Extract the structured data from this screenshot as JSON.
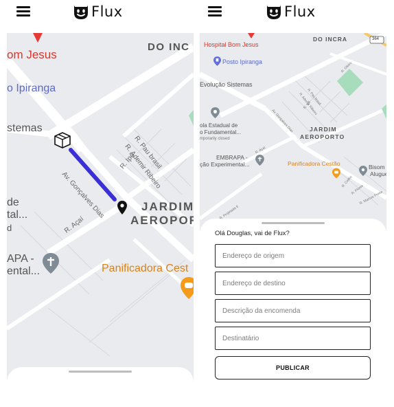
{
  "app": {
    "brand": "Flux"
  },
  "left_screen": {
    "map_labels": {
      "bom_jesus": "om Jesus",
      "ipiranga": "o Ipiranga",
      "sistemas": "stemas",
      "do_inc": "DO INC",
      "de": "de",
      "tal": "tal...",
      "d": "d",
      "apa": "APA -",
      "ental": "ental...",
      "jardim": "JARDIM",
      "aeroport": "AEROPORT",
      "panificadora": "Panificadora Cest",
      "av_goncalves_dias": "Av. Gonçalves Dias",
      "r_ipe": "R. Ipê",
      "r_pau_brasil": "R. Pau brasil",
      "r_ademir_ribeiro": "R. Ademir Ribeiro",
      "r_acai": "R. Açaí"
    }
  },
  "right_screen": {
    "map_labels": {
      "hospital": "Hospital Bom Jesus",
      "posto": "Posto Ipiranga",
      "evolucao": "Evolução Sistemas",
      "escola_1": "ola Estadual de",
      "escola_2": "o Fundamental...",
      "escola_3": "mporarily closed",
      "embrapa_1": "EMBRAPA -",
      "embrapa_2": "ção Experimental...",
      "do_incra": "DO INCRA",
      "jardim": "JARDIM",
      "aeroporto": "AEROPORTO",
      "panificadora": "Panificadora Cestão",
      "bisom_1": "Bisom",
      "bisom_2": "Alugue",
      "route_shield": "364",
      "r_acai": "R. Açaí",
      "r_goncalves": "Av. Gonçalves Dias",
      "r_ipe": "R. Ipê",
      "r_pau_brasil": "R. Pau brasil",
      "r_ademir": "R. Ademir Ribeiro",
      "r_oleiro": "R. Oleiro",
      "r_flores": "R. Flores",
      "r_cedro": "R. Cedro",
      "r_marcos": "R. Marcos Freire",
      "r_projetada": "R. Projetada 6"
    },
    "form": {
      "greeting": "Olá Douglas, vai de Flux?",
      "origin_placeholder": "Endereço de origem",
      "destination_placeholder": "Endereço de destino",
      "description_placeholder": "Descrição da encomenda",
      "recipient_placeholder": "Destinatário",
      "publish_label": "PUBLICAR"
    }
  },
  "colors": {
    "map_bg": "#e9ebee",
    "road": "#ffffff",
    "route": "#3b2fd6",
    "poi_red": "#e53935",
    "poi_blue": "#6470d9",
    "poi_gray": "#7f8b95",
    "poi_orange": "#f59b1c",
    "park": "#a7dcbc"
  }
}
